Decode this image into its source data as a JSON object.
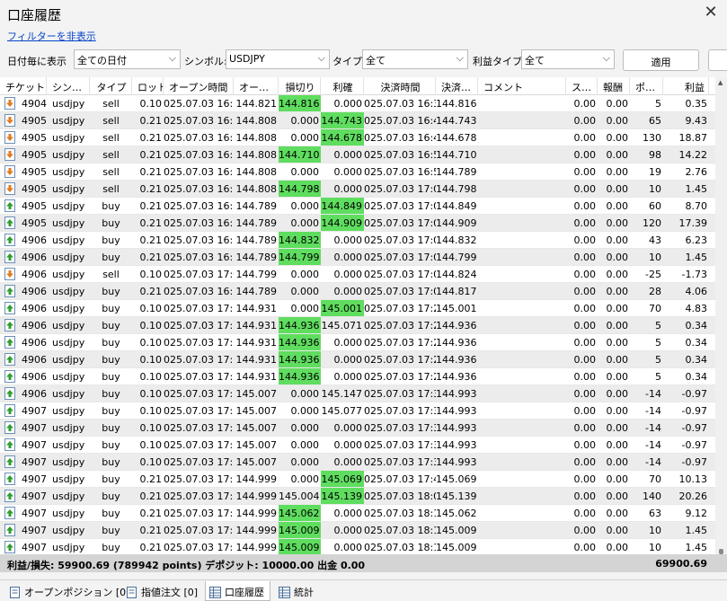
{
  "window": {
    "title": "口座履歴",
    "close_glyph": "✕"
  },
  "filter_link": "フィルターを非表示",
  "filters": {
    "period_label": "日付毎に表示",
    "period_value": "全ての日付",
    "symbol_label": "シンボル:",
    "symbol_value": "USDJPY",
    "type_label": "タイプ:",
    "type_value": "全て",
    "profit_type_label": "利益タイプ",
    "profit_type_value": "全て",
    "apply_label": "適用"
  },
  "columns": [
    "チケット",
    "シン…",
    "タイプ",
    "ロット",
    "オープン時間",
    "オー…",
    "損切り",
    "利確",
    "決済時間",
    "決済…",
    "コメント",
    "ス…",
    "報酬",
    "ポ…",
    "利益"
  ],
  "rows": [
    {
      "ticket": "4904",
      "symbol": "usdjpy",
      "type": "sell",
      "lot": "0.10",
      "open_time": "025.07.03 16:16",
      "open_price": "144.821",
      "sl": "144.816",
      "tp": "0.000",
      "close_time": "025.07.03 16:30",
      "close_price": "144.816",
      "swap": "0.00",
      "fee": "0.00",
      "points": "5",
      "profit": "0.35",
      "hl": "sl"
    },
    {
      "ticket": "4905",
      "symbol": "usdjpy",
      "type": "sell",
      "lot": "0.21",
      "open_time": "025.07.03 16:35",
      "open_price": "144.808",
      "sl": "0.000",
      "tp": "144.743",
      "close_time": "025.07.03 16:41",
      "close_price": "144.743",
      "swap": "0.00",
      "fee": "0.00",
      "points": "65",
      "profit": "9.43",
      "hl": "tp"
    },
    {
      "ticket": "4905",
      "symbol": "usdjpy",
      "type": "sell",
      "lot": "0.21",
      "open_time": "025.07.03 16:35",
      "open_price": "144.808",
      "sl": "0.000",
      "tp": "144.678",
      "close_time": "025.07.03 16:45",
      "close_price": "144.678",
      "swap": "0.00",
      "fee": "0.00",
      "points": "130",
      "profit": "18.87",
      "hl": "tp"
    },
    {
      "ticket": "4905",
      "symbol": "usdjpy",
      "type": "sell",
      "lot": "0.21",
      "open_time": "025.07.03 16:35",
      "open_price": "144.808",
      "sl": "144.710",
      "tp": "0.000",
      "close_time": "025.07.03 16:58",
      "close_price": "144.710",
      "swap": "0.00",
      "fee": "0.00",
      "points": "98",
      "profit": "14.22",
      "hl": "sl"
    },
    {
      "ticket": "4905",
      "symbol": "usdjpy",
      "type": "sell",
      "lot": "0.21",
      "open_time": "025.07.03 16:35",
      "open_price": "144.808",
      "sl": "0.000",
      "tp": "0.000",
      "close_time": "025.07.03 16:59",
      "close_price": "144.789",
      "swap": "0.00",
      "fee": "0.00",
      "points": "19",
      "profit": "2.76",
      "hl": ""
    },
    {
      "ticket": "4905",
      "symbol": "usdjpy",
      "type": "sell",
      "lot": "0.21",
      "open_time": "025.07.03 16:35",
      "open_price": "144.808",
      "sl": "144.798",
      "tp": "0.000",
      "close_time": "025.07.03 17:00",
      "close_price": "144.798",
      "swap": "0.00",
      "fee": "0.00",
      "points": "10",
      "profit": "1.45",
      "hl": "sl"
    },
    {
      "ticket": "4905",
      "symbol": "usdjpy",
      "type": "buy",
      "lot": "0.21",
      "open_time": "025.07.03 16:59",
      "open_price": "144.789",
      "sl": "0.000",
      "tp": "144.849",
      "close_time": "025.07.03 17:03",
      "close_price": "144.849",
      "swap": "0.00",
      "fee": "0.00",
      "points": "60",
      "profit": "8.70",
      "hl": "tp"
    },
    {
      "ticket": "4905",
      "symbol": "usdjpy",
      "type": "buy",
      "lot": "0.21",
      "open_time": "025.07.03 16:59",
      "open_price": "144.789",
      "sl": "0.000",
      "tp": "144.909",
      "close_time": "025.07.03 17:04",
      "close_price": "144.909",
      "swap": "0.00",
      "fee": "0.00",
      "points": "120",
      "profit": "17.39",
      "hl": "tp"
    },
    {
      "ticket": "4906",
      "symbol": "usdjpy",
      "type": "buy",
      "lot": "0.21",
      "open_time": "025.07.03 16:59",
      "open_price": "144.789",
      "sl": "144.832",
      "tp": "0.000",
      "close_time": "025.07.03 17:08",
      "close_price": "144.832",
      "swap": "0.00",
      "fee": "0.00",
      "points": "43",
      "profit": "6.23",
      "hl": "sl"
    },
    {
      "ticket": "4906",
      "symbol": "usdjpy",
      "type": "buy",
      "lot": "0.21",
      "open_time": "025.07.03 16:59",
      "open_price": "144.789",
      "sl": "144.799",
      "tp": "0.000",
      "close_time": "025.07.03 17:08",
      "close_price": "144.799",
      "swap": "0.00",
      "fee": "0.00",
      "points": "10",
      "profit": "1.45",
      "hl": "sl"
    },
    {
      "ticket": "4906",
      "symbol": "usdjpy",
      "type": "sell",
      "lot": "0.10",
      "open_time": "025.07.03 17:08",
      "open_price": "144.799",
      "sl": "0.000",
      "tp": "0.000",
      "close_time": "025.07.03 17:09",
      "close_price": "144.824",
      "swap": "0.00",
      "fee": "0.00",
      "points": "-25",
      "profit": "-1.73",
      "hl": ""
    },
    {
      "ticket": "4906",
      "symbol": "usdjpy",
      "type": "buy",
      "lot": "0.21",
      "open_time": "025.07.03 16:59",
      "open_price": "144.789",
      "sl": "0.000",
      "tp": "0.000",
      "close_time": "025.07.03 17:09",
      "close_price": "144.817",
      "swap": "0.00",
      "fee": "0.00",
      "points": "28",
      "profit": "4.06",
      "hl": ""
    },
    {
      "ticket": "4906",
      "symbol": "usdjpy",
      "type": "buy",
      "lot": "0.10",
      "open_time": "025.07.03 17:17",
      "open_price": "144.931",
      "sl": "0.000",
      "tp": "145.001",
      "close_time": "025.07.03 17:21",
      "close_price": "145.001",
      "swap": "0.00",
      "fee": "0.00",
      "points": "70",
      "profit": "4.83",
      "hl": "tp"
    },
    {
      "ticket": "4906",
      "symbol": "usdjpy",
      "type": "buy",
      "lot": "0.10",
      "open_time": "025.07.03 17:17",
      "open_price": "144.931",
      "sl": "144.936",
      "tp": "145.071",
      "close_time": "025.07.03 17:26",
      "close_price": "144.936",
      "swap": "0.00",
      "fee": "0.00",
      "points": "5",
      "profit": "0.34",
      "hl": "sl"
    },
    {
      "ticket": "4906",
      "symbol": "usdjpy",
      "type": "buy",
      "lot": "0.10",
      "open_time": "025.07.03 17:17",
      "open_price": "144.931",
      "sl": "144.936",
      "tp": "0.000",
      "close_time": "025.07.03 17:26",
      "close_price": "144.936",
      "swap": "0.00",
      "fee": "0.00",
      "points": "5",
      "profit": "0.34",
      "hl": "sl"
    },
    {
      "ticket": "4906",
      "symbol": "usdjpy",
      "type": "buy",
      "lot": "0.10",
      "open_time": "025.07.03 17:17",
      "open_price": "144.931",
      "sl": "144.936",
      "tp": "0.000",
      "close_time": "025.07.03 17:26",
      "close_price": "144.936",
      "swap": "0.00",
      "fee": "0.00",
      "points": "5",
      "profit": "0.34",
      "hl": "sl"
    },
    {
      "ticket": "4906",
      "symbol": "usdjpy",
      "type": "buy",
      "lot": "0.10",
      "open_time": "025.07.03 17:17",
      "open_price": "144.931",
      "sl": "144.936",
      "tp": "0.000",
      "close_time": "025.07.03 17:26",
      "close_price": "144.936",
      "swap": "0.00",
      "fee": "0.00",
      "points": "5",
      "profit": "0.34",
      "hl": "sl"
    },
    {
      "ticket": "4906",
      "symbol": "usdjpy",
      "type": "buy",
      "lot": "0.10",
      "open_time": "025.07.03 17:36",
      "open_price": "145.007",
      "sl": "0.000",
      "tp": "145.147",
      "close_time": "025.07.03 17:39",
      "close_price": "144.993",
      "swap": "0.00",
      "fee": "0.00",
      "points": "-14",
      "profit": "-0.97",
      "hl": ""
    },
    {
      "ticket": "4907",
      "symbol": "usdjpy",
      "type": "buy",
      "lot": "0.10",
      "open_time": "025.07.03 17:36",
      "open_price": "145.007",
      "sl": "0.000",
      "tp": "145.077",
      "close_time": "025.07.03 17:39",
      "close_price": "144.993",
      "swap": "0.00",
      "fee": "0.00",
      "points": "-14",
      "profit": "-0.97",
      "hl": ""
    },
    {
      "ticket": "4907",
      "symbol": "usdjpy",
      "type": "buy",
      "lot": "0.10",
      "open_time": "025.07.03 17:36",
      "open_price": "145.007",
      "sl": "0.000",
      "tp": "0.000",
      "close_time": "025.07.03 17:39",
      "close_price": "144.993",
      "swap": "0.00",
      "fee": "0.00",
      "points": "-14",
      "profit": "-0.97",
      "hl": ""
    },
    {
      "ticket": "4907",
      "symbol": "usdjpy",
      "type": "buy",
      "lot": "0.10",
      "open_time": "025.07.03 17:36",
      "open_price": "145.007",
      "sl": "0.000",
      "tp": "0.000",
      "close_time": "025.07.03 17:39",
      "close_price": "144.993",
      "swap": "0.00",
      "fee": "0.00",
      "points": "-14",
      "profit": "-0.97",
      "hl": ""
    },
    {
      "ticket": "4907",
      "symbol": "usdjpy",
      "type": "buy",
      "lot": "0.10",
      "open_time": "025.07.03 17:36",
      "open_price": "145.007",
      "sl": "0.000",
      "tp": "0.000",
      "close_time": "025.07.03 17:39",
      "close_price": "144.993",
      "swap": "0.00",
      "fee": "0.00",
      "points": "-14",
      "profit": "-0.97",
      "hl": ""
    },
    {
      "ticket": "4907",
      "symbol": "usdjpy",
      "type": "buy",
      "lot": "0.21",
      "open_time": "025.07.03 17:39",
      "open_price": "144.999",
      "sl": "0.000",
      "tp": "145.069",
      "close_time": "025.07.03 17:41",
      "close_price": "145.069",
      "swap": "0.00",
      "fee": "0.00",
      "points": "70",
      "profit": "10.13",
      "hl": "tp"
    },
    {
      "ticket": "4907",
      "symbol": "usdjpy",
      "type": "buy",
      "lot": "0.21",
      "open_time": "025.07.03 17:39",
      "open_price": "144.999",
      "sl": "145.004",
      "tp": "145.139",
      "close_time": "025.07.03 18:02",
      "close_price": "145.139",
      "swap": "0.00",
      "fee": "0.00",
      "points": "140",
      "profit": "20.26",
      "hl": "tp"
    },
    {
      "ticket": "4907",
      "symbol": "usdjpy",
      "type": "buy",
      "lot": "0.21",
      "open_time": "025.07.03 17:39",
      "open_price": "144.999",
      "sl": "145.062",
      "tp": "0.000",
      "close_time": "025.07.03 18:12",
      "close_price": "145.062",
      "swap": "0.00",
      "fee": "0.00",
      "points": "63",
      "profit": "9.12",
      "hl": "sl"
    },
    {
      "ticket": "4907",
      "symbol": "usdjpy",
      "type": "buy",
      "lot": "0.21",
      "open_time": "025.07.03 17:39",
      "open_price": "144.999",
      "sl": "145.009",
      "tp": "0.000",
      "close_time": "025.07.03 18:13",
      "close_price": "145.009",
      "swap": "0.00",
      "fee": "0.00",
      "points": "10",
      "profit": "1.45",
      "hl": "sl"
    },
    {
      "ticket": "4907",
      "symbol": "usdjpy",
      "type": "buy",
      "lot": "0.21",
      "open_time": "025.07.03 17:39",
      "open_price": "144.999",
      "sl": "145.009",
      "tp": "0.000",
      "close_time": "025.07.03 18:13",
      "close_price": "145.009",
      "swap": "0.00",
      "fee": "0.00",
      "points": "10",
      "profit": "1.45",
      "hl": "sl"
    }
  ],
  "totals": {
    "text": "利益/損失: 59900.69 (789942 points) デポジット: 10000.00 出金 0.00",
    "profit": "69900.69"
  },
  "tabs": [
    {
      "label": "オープンポジション [0]",
      "icon": "tab-page-icon",
      "active": false
    },
    {
      "label": "指値注文 [0]",
      "icon": "tab-page-icon",
      "active": false
    },
    {
      "label": "口座履歴",
      "icon": "tab-table-icon",
      "active": true
    },
    {
      "label": "統計",
      "icon": "tab-table-icon",
      "active": false
    }
  ],
  "colors": {
    "highlight": "#5fdd5f",
    "buy_icon": "#2e9e2e",
    "sell_icon": "#e07b22",
    "link": "#0645c8"
  }
}
